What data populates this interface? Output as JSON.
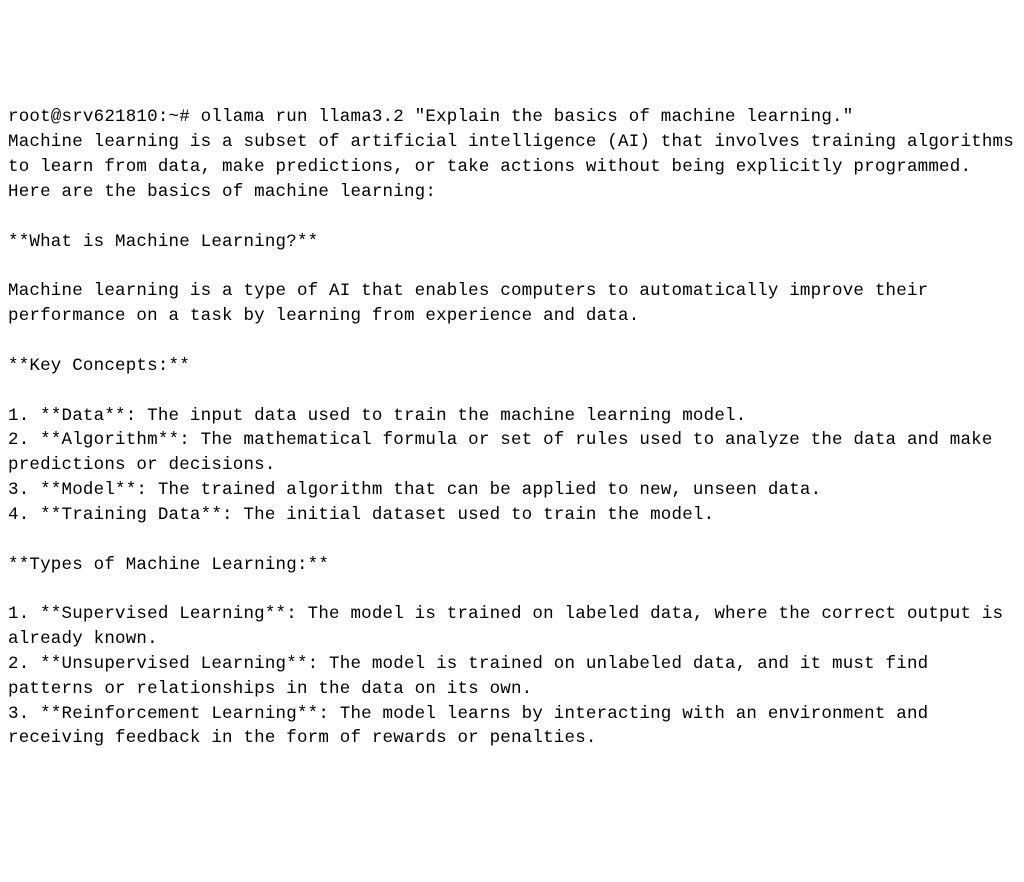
{
  "prompt_line": "root@srv621810:~# ollama run llama3.2 \"Explain the basics of machine learning.\"",
  "output": {
    "intro": "Machine learning is a subset of artificial intelligence (AI) that involves training algorithms to learn from data, make predictions, or take actions without being explicitly programmed. Here are the basics of machine learning:",
    "section1_title": "**What is Machine Learning?**",
    "section1_body": "Machine learning is a type of AI that enables computers to automatically improve their performance on a task by learning from experience and data.",
    "section2_title": "**Key Concepts:**",
    "key_concept_1": "1. **Data**: The input data used to train the machine learning model.",
    "key_concept_2": "2. **Algorithm**: The mathematical formula or set of rules used to analyze the data and make predictions or decisions.",
    "key_concept_3": "3. **Model**: The trained algorithm that can be applied to new, unseen data.",
    "key_concept_4": "4. **Training Data**: The initial dataset used to train the model.",
    "section3_title": "**Types of Machine Learning:**",
    "type_1": "1. **Supervised Learning**: The model is trained on labeled data, where the correct output is already known.",
    "type_2": "2. **Unsupervised Learning**: The model is trained on unlabeled data, and it must find patterns or relationships in the data on its own.",
    "type_3": "3. **Reinforcement Learning**: The model learns by interacting with an environment and receiving feedback in the form of rewards or penalties."
  }
}
